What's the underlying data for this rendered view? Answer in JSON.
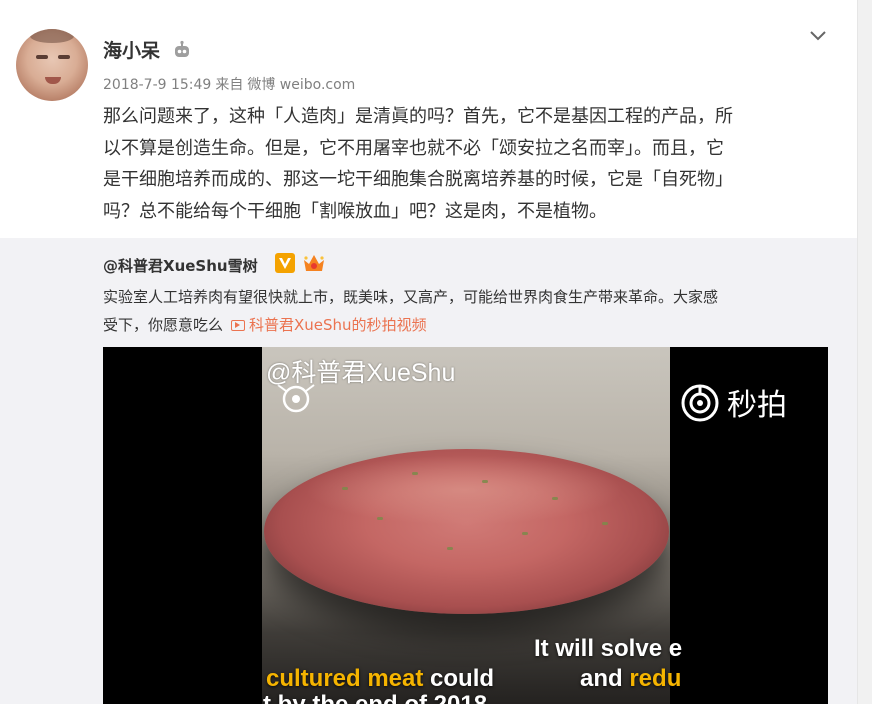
{
  "post": {
    "username": "海小呆",
    "date": "2018-7-9 15:49",
    "from_label": "来自",
    "source": "微博 weibo.com",
    "text_lines": [
      "那么问题来了，这种「人造肉」是清眞的吗？首先，它不是基因工程的产品，所",
      "以不算是创造生命。但是，它不用屠宰也就不必「颂安拉之名而宰」。而且，它",
      "是干细胞培养而成的、那这一坨干细胞集合脱离培养基的时候，它是「自死物」",
      "吗？总不能给每个干细胞「割喉放血」吧？这是肉，不是植物。"
    ]
  },
  "repost": {
    "author": "@科普君XueShu雪树",
    "text_line1": "实验室人工培养肉有望很快就上市，既美味，又高产，可能给世界肉食生产带来革命。大家感",
    "text_line2": "受下，你愿意吃么",
    "video_link": "科普君XueShu的秒拍视频"
  },
  "video": {
    "watermark": "@科普君XueShu",
    "brand": "秒拍",
    "caption_left_y": "cultured meat",
    "caption_left_w": " could",
    "caption_left_2": "t by the end of 2018",
    "caption_right_1": "It will solve e",
    "caption_right_2_w": "and ",
    "caption_right_2_y": "redu"
  },
  "icons": [
    "robot-badge-icon",
    "chevron-down-icon",
    "verified-v-icon",
    "crown-badge-icon",
    "video-link-icon",
    "miaopai-logo-icon"
  ],
  "colors": {
    "link": "#eb7350",
    "repost_bg": "#f2f2f5",
    "caption_yellow": "#f5b400",
    "verified_orange": "#f4a200"
  }
}
